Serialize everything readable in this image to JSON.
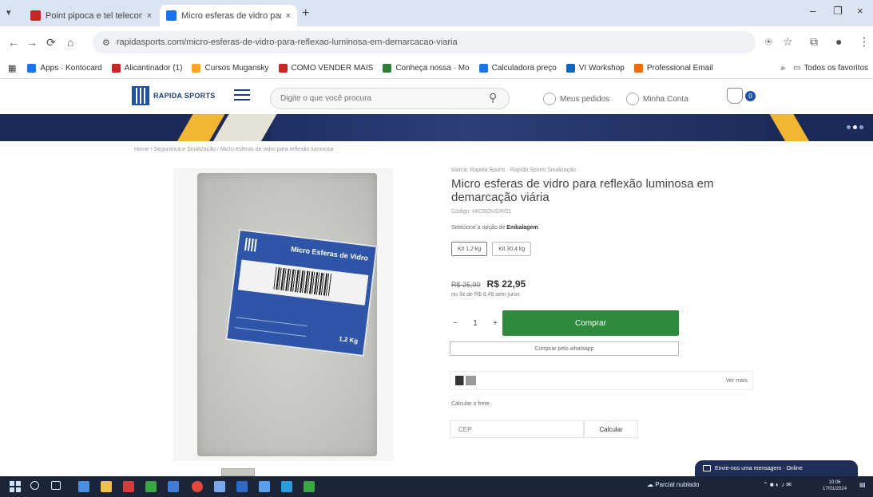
{
  "browser": {
    "tabs": [
      {
        "label": "Point pipoca e tel telecom SRL",
        "close": "×",
        "favicon_color": "#c62828",
        "active": false
      },
      {
        "label": "Micro esferas de vidro para re",
        "close": "×",
        "favicon_color": "#1a73e8",
        "active": true
      }
    ],
    "new_tab": "+",
    "tab_menu": "▾",
    "window_controls": {
      "minimize": "–",
      "maximize": "❐",
      "close": "×"
    },
    "nav": {
      "back": "←",
      "forward": "→",
      "reload": "⟳",
      "home": "⌂"
    },
    "url": "rapidasports.com/micro-esferas-de-vidro-para-reflexao-luminosa-em-demarcacao-viaria",
    "toolbar_icons": {
      "translate": "⍟",
      "star": "☆",
      "extensions": "⧉",
      "profile": "●",
      "menu": "⋮"
    },
    "bookmarks": [
      {
        "label": "Apps · Kontocard",
        "color": "#1a73e8"
      },
      {
        "label": "Alicantinador (1)",
        "color": "#c62828"
      },
      {
        "label": "Cursos Mugansky",
        "color": "#f9a825"
      },
      {
        "label": "COMO VENDER MAIS",
        "color": "#c62828"
      },
      {
        "label": "Conheça nossa · Mo",
        "color": "#2e7d32"
      },
      {
        "label": "Calculadora preço",
        "color": "#1a73e8"
      },
      {
        "label": "VI Workshop",
        "color": "#1565c0"
      },
      {
        "label": "Professional Email",
        "color": "#ef6c00"
      }
    ],
    "bookmarks_right": {
      "more": "»",
      "folder_label": "Todos os favoritos"
    }
  },
  "site": {
    "logo_text": "RAPIDA SPORTS",
    "search_placeholder": "Digite o que você procura",
    "search_icon": "⚲",
    "account_link": "Meus pedidos",
    "login_link": "Minha Conta",
    "cart_count": "0",
    "breadcrumb": "Home  /  Segurança e Sinalização  /  Micro esferas de vidro para reflexão luminosa"
  },
  "product": {
    "brand_line": "Marca: Rapida Sports · Rapida Sports Sinalização",
    "title": "Micro esferas de vidro para reflexão luminosa em demarcação viária",
    "code": "Código: MICROVIDRO1",
    "select_prefix": "Selecione a opção de ",
    "select_bold": "Embalagem",
    "options": [
      {
        "label": "Kit 1,2 kg",
        "selected": true
      },
      {
        "label": "Kit 30,4 kg",
        "selected": false
      }
    ],
    "old_price": "R$ 25,90",
    "price": "R$ 22,95",
    "installments": "ou 3x de R$ 8,49 sem juros",
    "qty_minus": "−",
    "qty_value": "1",
    "qty_plus": "+",
    "buy_label": "Comprar",
    "gift_label": "Comprar pelo whatsapp",
    "payment_link": "Ver mais",
    "shipping_label": "Calcular o frete:",
    "cep_placeholder": "CEP",
    "calc_label": "Calcular",
    "image_label_title": "Micro Esferas de Vidro",
    "image_label_weight": "1,2 Kg"
  },
  "chat": {
    "text": "Envie-nos uma mensagem · Online"
  },
  "taskbar": {
    "tray_text": "Parcial nublado",
    "time": "10:06",
    "date": "17/01/2024"
  }
}
